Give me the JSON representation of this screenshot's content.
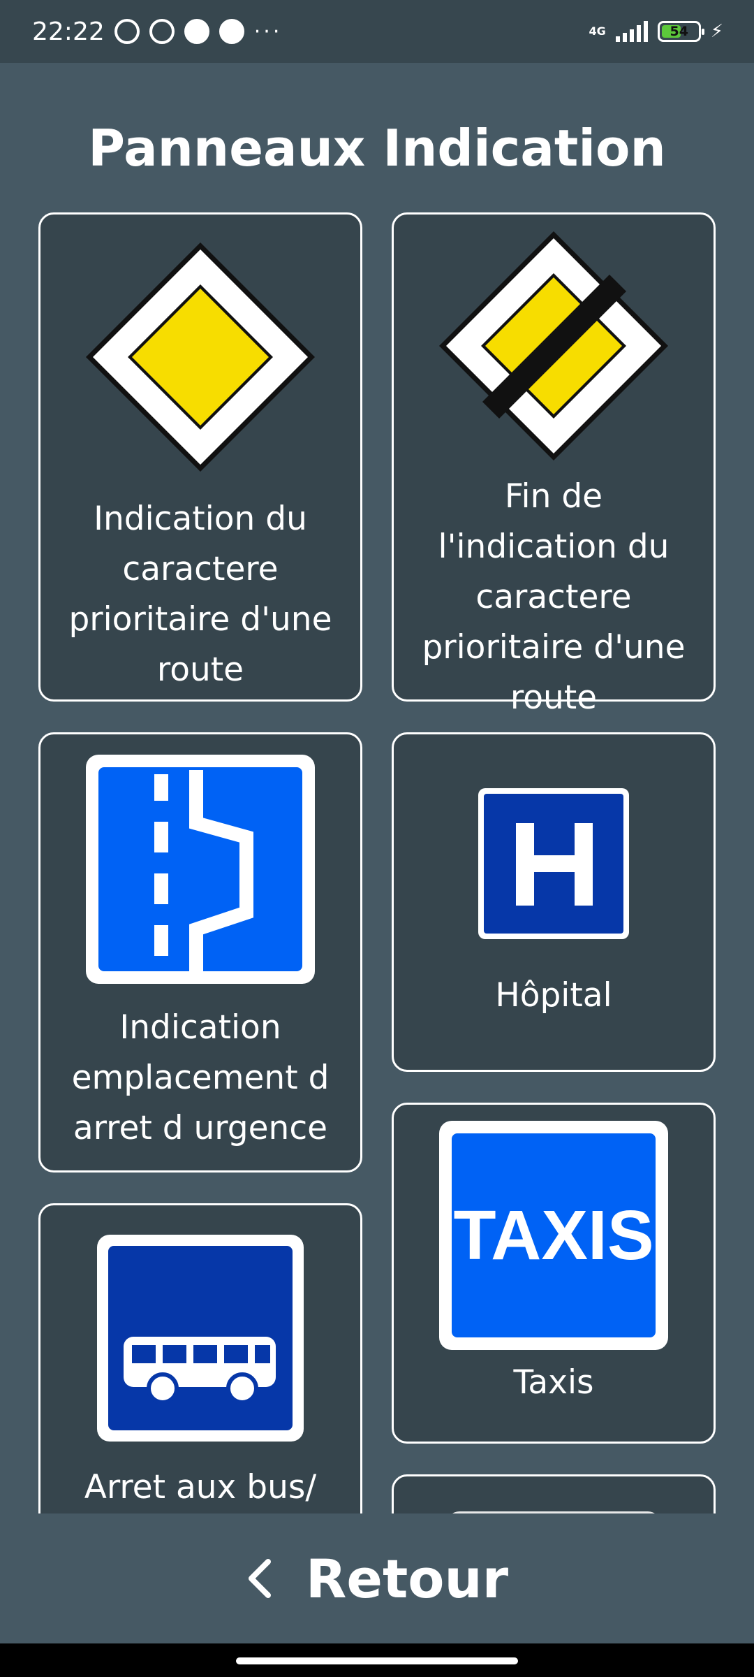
{
  "status_bar": {
    "time": "22:22",
    "network": "4G",
    "battery": "54",
    "battery_level": 0.54,
    "icons": [
      "alarm-icon",
      "whatsapp-icon",
      "message-icon",
      "app-icon",
      "more-icon"
    ]
  },
  "header": {
    "title": "Panneaux Indication"
  },
  "signs": [
    {
      "label": "Indication du caractere prioritaire d'une route",
      "icon": "priority-road-sign-icon"
    },
    {
      "label": "Fin de l'indication du caractere prioritaire d'une route",
      "icon": "end-priority-road-sign-icon"
    },
    {
      "label": "Indication emplacement d arret d urgence",
      "icon": "emergency-stop-area-sign-icon"
    },
    {
      "label": "Hôpital",
      "icon": "hospital-sign-icon"
    },
    {
      "label": "Arret aux bus/",
      "icon": "bus-stop-sign-icon"
    },
    {
      "label": "Taxis",
      "icon": "taxi-sign-icon",
      "sign_text": "TAXIS"
    },
    {
      "label": "",
      "icon": "partial-sign-icon"
    }
  ],
  "footer": {
    "back_label": "Retour",
    "back_icon": "chevron-left-icon"
  },
  "colors": {
    "background": "#465964",
    "card": "#36454d",
    "sign_blue": "#0062f5",
    "sign_dark_blue": "#0637a8",
    "priority_yellow": "#f7dd00"
  }
}
